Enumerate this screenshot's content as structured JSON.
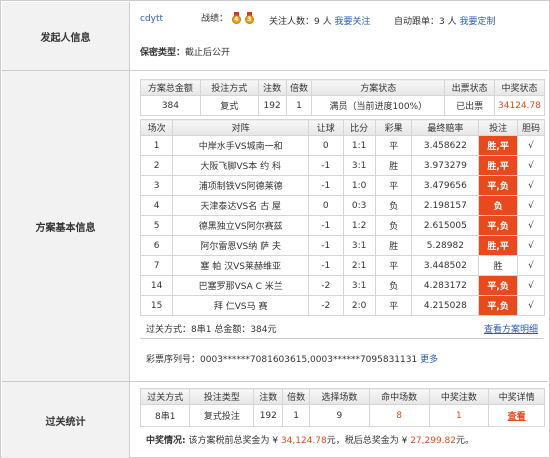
{
  "sections": {
    "initiator": "发起人信息",
    "plan": "方案基本信息",
    "pass": "过关统计"
  },
  "initiator": {
    "username": "cdytt",
    "record_label": "战绩：",
    "medal_1": "4",
    "medal_2": "3",
    "follow_label": "关注人数：",
    "follow_count": "9 人",
    "follow_link": "我要关注",
    "autofollow_label": "自动跟单：",
    "autofollow_count": "3 人",
    "autofollow_link": "我要定制",
    "secret_label": "保密类型：",
    "secret_value": "截止后公开"
  },
  "summary": {
    "headers": [
      "方案总金额",
      "投注方式",
      "注数",
      "倍数",
      "方案状态",
      "出票状态",
      "中奖状态"
    ],
    "amount": "384",
    "method": "复式",
    "bets": "192",
    "multiple": "1",
    "status": "满员（当前进度100%）",
    "ticket": "已出票",
    "prize": "34124.78"
  },
  "matches": {
    "headers": [
      "场次",
      "对阵",
      "让球",
      "比分",
      "彩果",
      "最终赔率",
      "投注",
      "胆码"
    ],
    "rows": [
      {
        "no": "1",
        "match": "中岸水手VS城南一和",
        "handicap": "0",
        "score": "1:1",
        "result": "平",
        "odds": "3.458622",
        "bet": "胜,平",
        "bet_on": true,
        "banker": "√"
      },
      {
        "no": "2",
        "match": "大阪飞脚VS本 约 科",
        "handicap": "-1",
        "score": "3:1",
        "result": "胜",
        "odds": "3.973279",
        "bet": "胜,平",
        "bet_on": true,
        "banker": "√"
      },
      {
        "no": "3",
        "match": "浦项制铁VS阿德莱德",
        "handicap": "-1",
        "score": "1:0",
        "result": "平",
        "odds": "3.479656",
        "bet": "平,负",
        "bet_on": true,
        "banker": "√"
      },
      {
        "no": "4",
        "match": "天津泰达VS名 古 屋",
        "handicap": "0",
        "score": "0:3",
        "result": "负",
        "odds": "2.198157",
        "bet": "负",
        "bet_on": true,
        "banker": "√"
      },
      {
        "no": "5",
        "match": "德黑独立VS阿尔赛兹",
        "handicap": "-1",
        "score": "1:2",
        "result": "负",
        "odds": "2.615005",
        "bet": "平,负",
        "bet_on": true,
        "banker": "√"
      },
      {
        "no": "6",
        "match": "阿尔雷恩VS纳 萨 夫",
        "handicap": "-1",
        "score": "3:1",
        "result": "胜",
        "odds": "5.28982",
        "bet": "胜,平",
        "bet_on": true,
        "banker": "√"
      },
      {
        "no": "7",
        "match": "塞 帕 汉VS莱赫维亚",
        "handicap": "-1",
        "score": "2:1",
        "result": "平",
        "odds": "3.448502",
        "bet": "胜",
        "bet_on": false,
        "banker": "√"
      },
      {
        "no": "14",
        "match": "巴塞罗那VSA C 米兰",
        "handicap": "-2",
        "score": "3:1",
        "result": "负",
        "odds": "4.283172",
        "bet": "平,负",
        "bet_on": true,
        "banker": "√"
      },
      {
        "no": "15",
        "match": "拜 仁VS马 赛",
        "handicap": "-2",
        "score": "2:0",
        "result": "平",
        "odds": "4.215028",
        "bet": "平,负",
        "bet_on": true,
        "banker": "√"
      }
    ],
    "pass_text": "过关方式：8串1 总金额：384元",
    "detail_link": "查看方案明细"
  },
  "serial": {
    "label": "彩票序列号：",
    "value": "0003******7081603615,0003******7095831131",
    "more": "更多"
  },
  "pass_stats": {
    "headers": [
      "过关方式",
      "投注类型",
      "注数",
      "倍数",
      "选择场数",
      "命中场数",
      "中奖注数",
      "中奖详情"
    ],
    "row": {
      "mode": "8串1",
      "type": "复式投注",
      "bets": "192",
      "multiple": "1",
      "chosen": "9",
      "hit": "8",
      "wins": "1",
      "detail": "查看"
    }
  },
  "prize_info": {
    "label": "中奖情况:",
    "text1": "该方案税前总奖金为 ¥ ",
    "pretax": "34,124.78",
    "text2": "元，税后总奖金为 ¥ ",
    "aftertax": "27,299.82",
    "text3": "元。"
  }
}
